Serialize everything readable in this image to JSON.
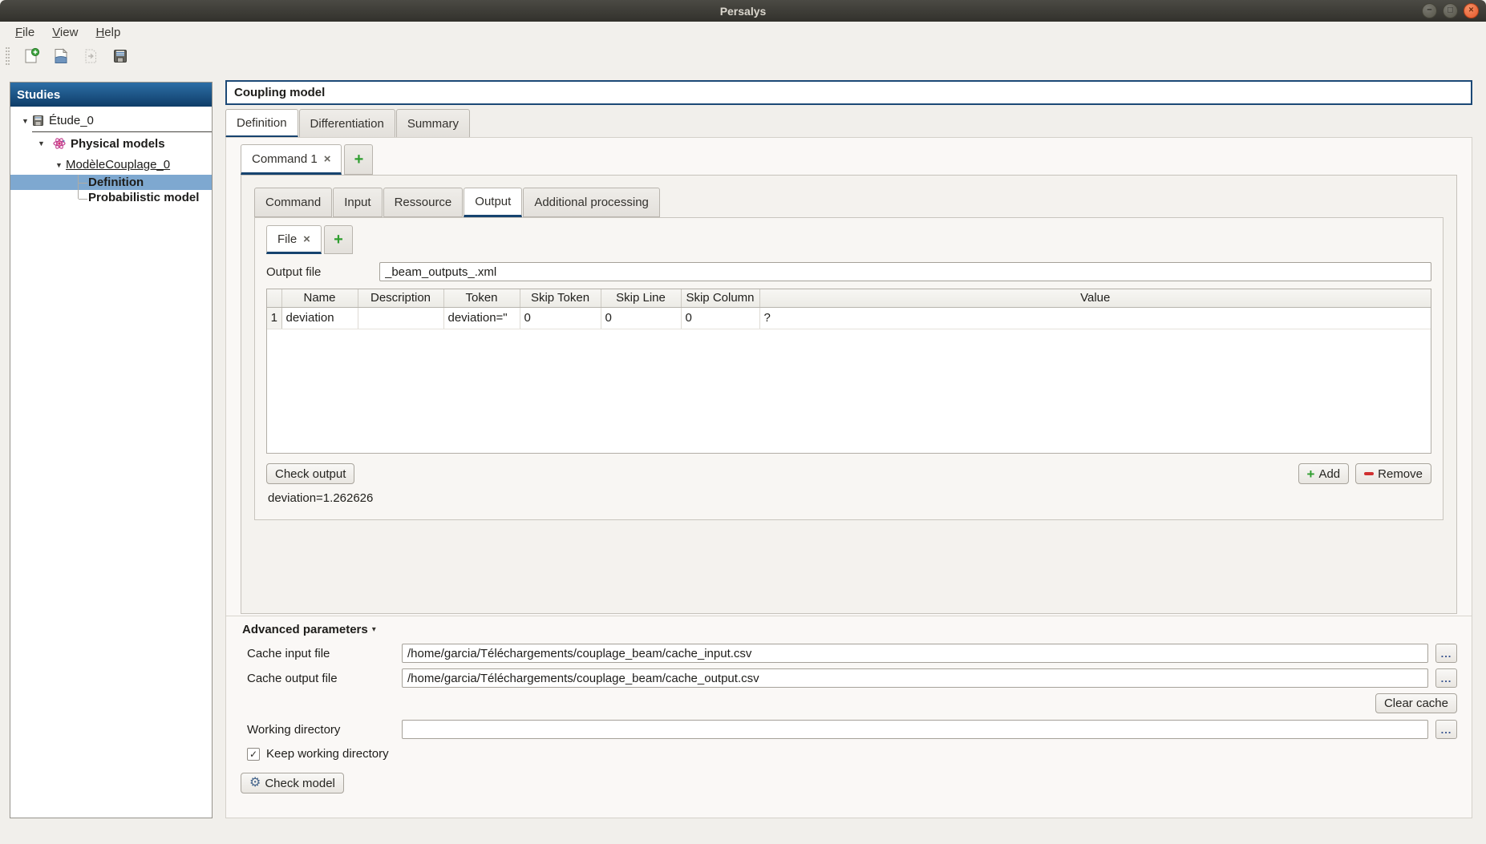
{
  "window": {
    "title": "Persalys"
  },
  "menubar": {
    "items": [
      {
        "mnemonic": "F",
        "rest": "ile"
      },
      {
        "mnemonic": "V",
        "rest": "iew"
      },
      {
        "mnemonic": "H",
        "rest": "elp"
      }
    ]
  },
  "sidebar": {
    "title": "Studies",
    "items": {
      "study": "Étude_0",
      "physical_models": "Physical models",
      "model": "ModèleCouplage_0",
      "definition": "Definition",
      "probabilistic": "Probabilistic model"
    }
  },
  "main": {
    "title": "Coupling model",
    "tabs": [
      "Definition",
      "Differentiation",
      "Summary"
    ],
    "command_tab": "Command 1",
    "subtabs": [
      "Command",
      "Input",
      "Ressource",
      "Output",
      "Additional processing"
    ],
    "file_tab": "File",
    "output": {
      "file_label": "Output file",
      "file_value": "_beam_outputs_.xml",
      "table": {
        "columns": [
          "Name",
          "Description",
          "Token",
          "Skip Token",
          "Skip Line",
          "Skip Column",
          "Value"
        ],
        "rows": [
          {
            "num": "1",
            "cells": [
              "deviation",
              "",
              "deviation=\"",
              "0",
              "0",
              "0",
              "?"
            ]
          }
        ]
      },
      "check_output": "Check output",
      "result": "deviation=1.262626",
      "add": "Add",
      "remove": "Remove"
    },
    "advanced": {
      "title": "Advanced parameters",
      "cache_input_label": "Cache input file",
      "cache_input_value": "/home/garcia/Téléchargements/couplage_beam/cache_input.csv",
      "cache_output_label": "Cache output file",
      "cache_output_value": "/home/garcia/Téléchargements/couplage_beam/cache_output.csv",
      "browse": "...",
      "clear_cache": "Clear cache",
      "working_dir_label": "Working directory",
      "working_dir_value": "",
      "keep_working_dir": "Keep working directory",
      "check_model": "Check model"
    }
  },
  "icons": {
    "minimize": "−",
    "maximize": "□",
    "close_window": "×",
    "close_tab": "×",
    "plus": "+",
    "expand": "▼",
    "collapse": "▾",
    "check": "✓",
    "gear": "⚙"
  },
  "colors": {
    "accent": "#16436f",
    "selection": "#7ea8d0",
    "close_button": "#e6582b",
    "plus_green": "#2f9e2f",
    "remove_red": "#d03030"
  }
}
